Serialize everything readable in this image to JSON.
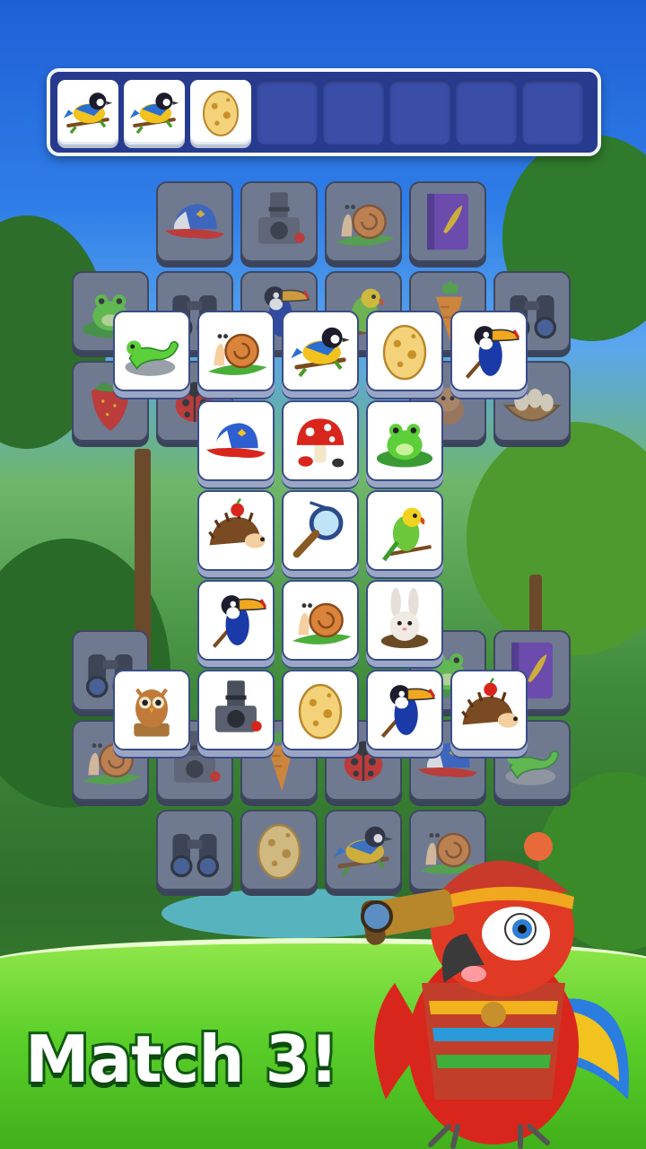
{
  "headline": "Match 3!",
  "slot_bar": {
    "capacity": 8,
    "filled": [
      "bird-icon",
      "bird-icon",
      "egg-icon"
    ]
  },
  "colors": {
    "tile_front": "#ffffff",
    "tile_border": "#3a4c86",
    "slot_bar_bg": "#263a8e",
    "headline_stroke": "#0f5a12"
  },
  "tiles": {
    "back_layer": [
      "cap-icon",
      "camera-icon",
      "snail-icon",
      "notebook-icon",
      "frog-icon",
      "binoculars-icon",
      "toucan-icon",
      "parakeet-icon",
      "carrot-icon",
      "binoculars-icon",
      "strawberry-icon",
      "ladybug-icon",
      "mouse-icon",
      "nest-icon",
      "binoculars-icon",
      "notebook-icon",
      "frog-icon",
      "snail-icon",
      "camera-icon",
      "carrot-icon",
      "ladybug-icon",
      "cap-icon",
      "lizard-icon",
      "binoculars-icon",
      "egg-icon",
      "bird-icon",
      "snail-icon"
    ],
    "front_layer": [
      "lizard-icon",
      "snail-icon",
      "bird-icon",
      "egg-icon",
      "toucan-icon",
      "cap-icon",
      "mushroom-icon",
      "frog-icon",
      "hedgehog-icon",
      "magnifier-icon",
      "parakeet-icon",
      "toucan-icon",
      "snail-icon",
      "rabbit-icon",
      "owl-icon",
      "camera-icon",
      "egg-icon",
      "toucan-icon",
      "hedgehog-icon"
    ]
  }
}
